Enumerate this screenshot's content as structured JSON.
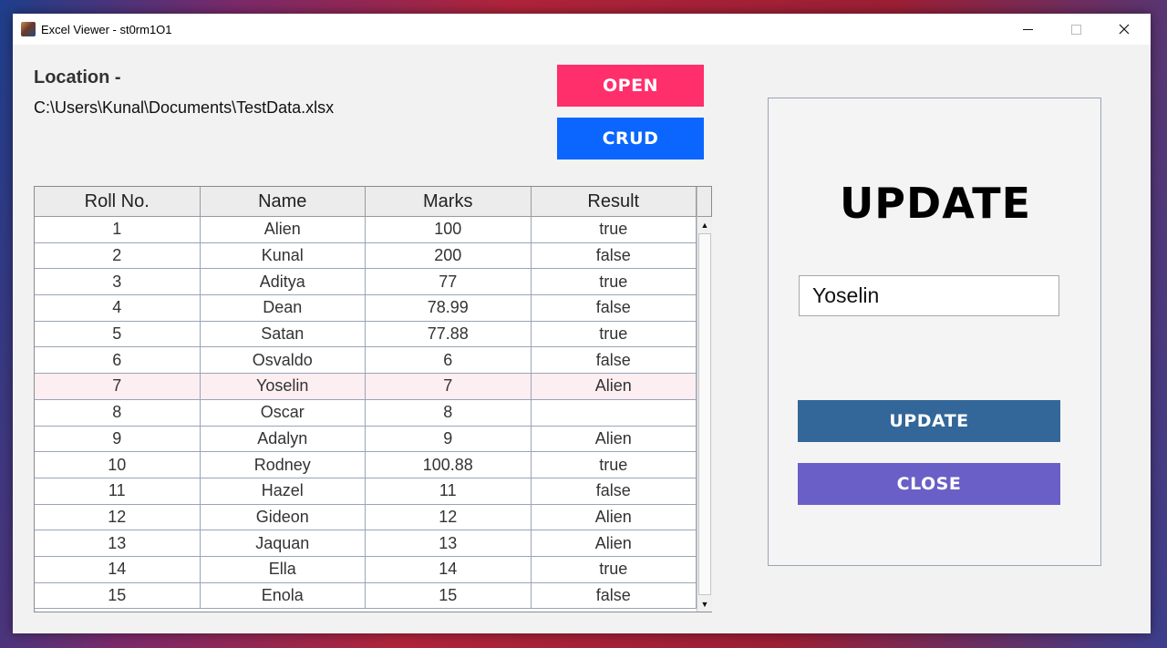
{
  "window": {
    "title": "Excel Viewer - st0rm1O1",
    "controls": {
      "minimize": "—",
      "maximize": "☐",
      "close": "✕"
    }
  },
  "location": {
    "label": "Location -",
    "path": "C:\\Users\\Kunal\\Documents\\TestData.xlsx"
  },
  "buttons": {
    "open": "OPEN",
    "crud": "CRUD"
  },
  "table": {
    "headers": [
      "Roll No.",
      "Name",
      "Marks",
      "Result"
    ],
    "selected_row_index": 6,
    "rows": [
      [
        "1",
        "Alien",
        "100",
        "true"
      ],
      [
        "2",
        "Kunal",
        "200",
        "false"
      ],
      [
        "3",
        "Aditya",
        "77",
        "true"
      ],
      [
        "4",
        "Dean",
        "78.99",
        "false"
      ],
      [
        "5",
        "Satan",
        "77.88",
        "true"
      ],
      [
        "6",
        "Osvaldo",
        "6",
        "false"
      ],
      [
        "7",
        "Yoselin",
        "7",
        "Alien"
      ],
      [
        "8",
        "Oscar",
        "8",
        ""
      ],
      [
        "9",
        "Adalyn",
        "9",
        "Alien"
      ],
      [
        "10",
        "Rodney",
        "100.88",
        "true"
      ],
      [
        "11",
        "Hazel",
        "11",
        "false"
      ],
      [
        "12",
        "Gideon",
        "12",
        "Alien"
      ],
      [
        "13",
        "Jaquan",
        "13",
        "Alien"
      ],
      [
        "14",
        "Ella",
        "14",
        "true"
      ],
      [
        "15",
        "Enola",
        "15",
        "false"
      ]
    ]
  },
  "update_panel": {
    "title": "UPDATE",
    "input_value": "Yoselin",
    "update_label": "UPDATE",
    "close_label": "CLOSE"
  },
  "colors": {
    "open": "#ff2f6b",
    "crud": "#0a66ff",
    "update": "#336699",
    "close": "#6a5fc7",
    "selected_row": "#fdeef2"
  }
}
